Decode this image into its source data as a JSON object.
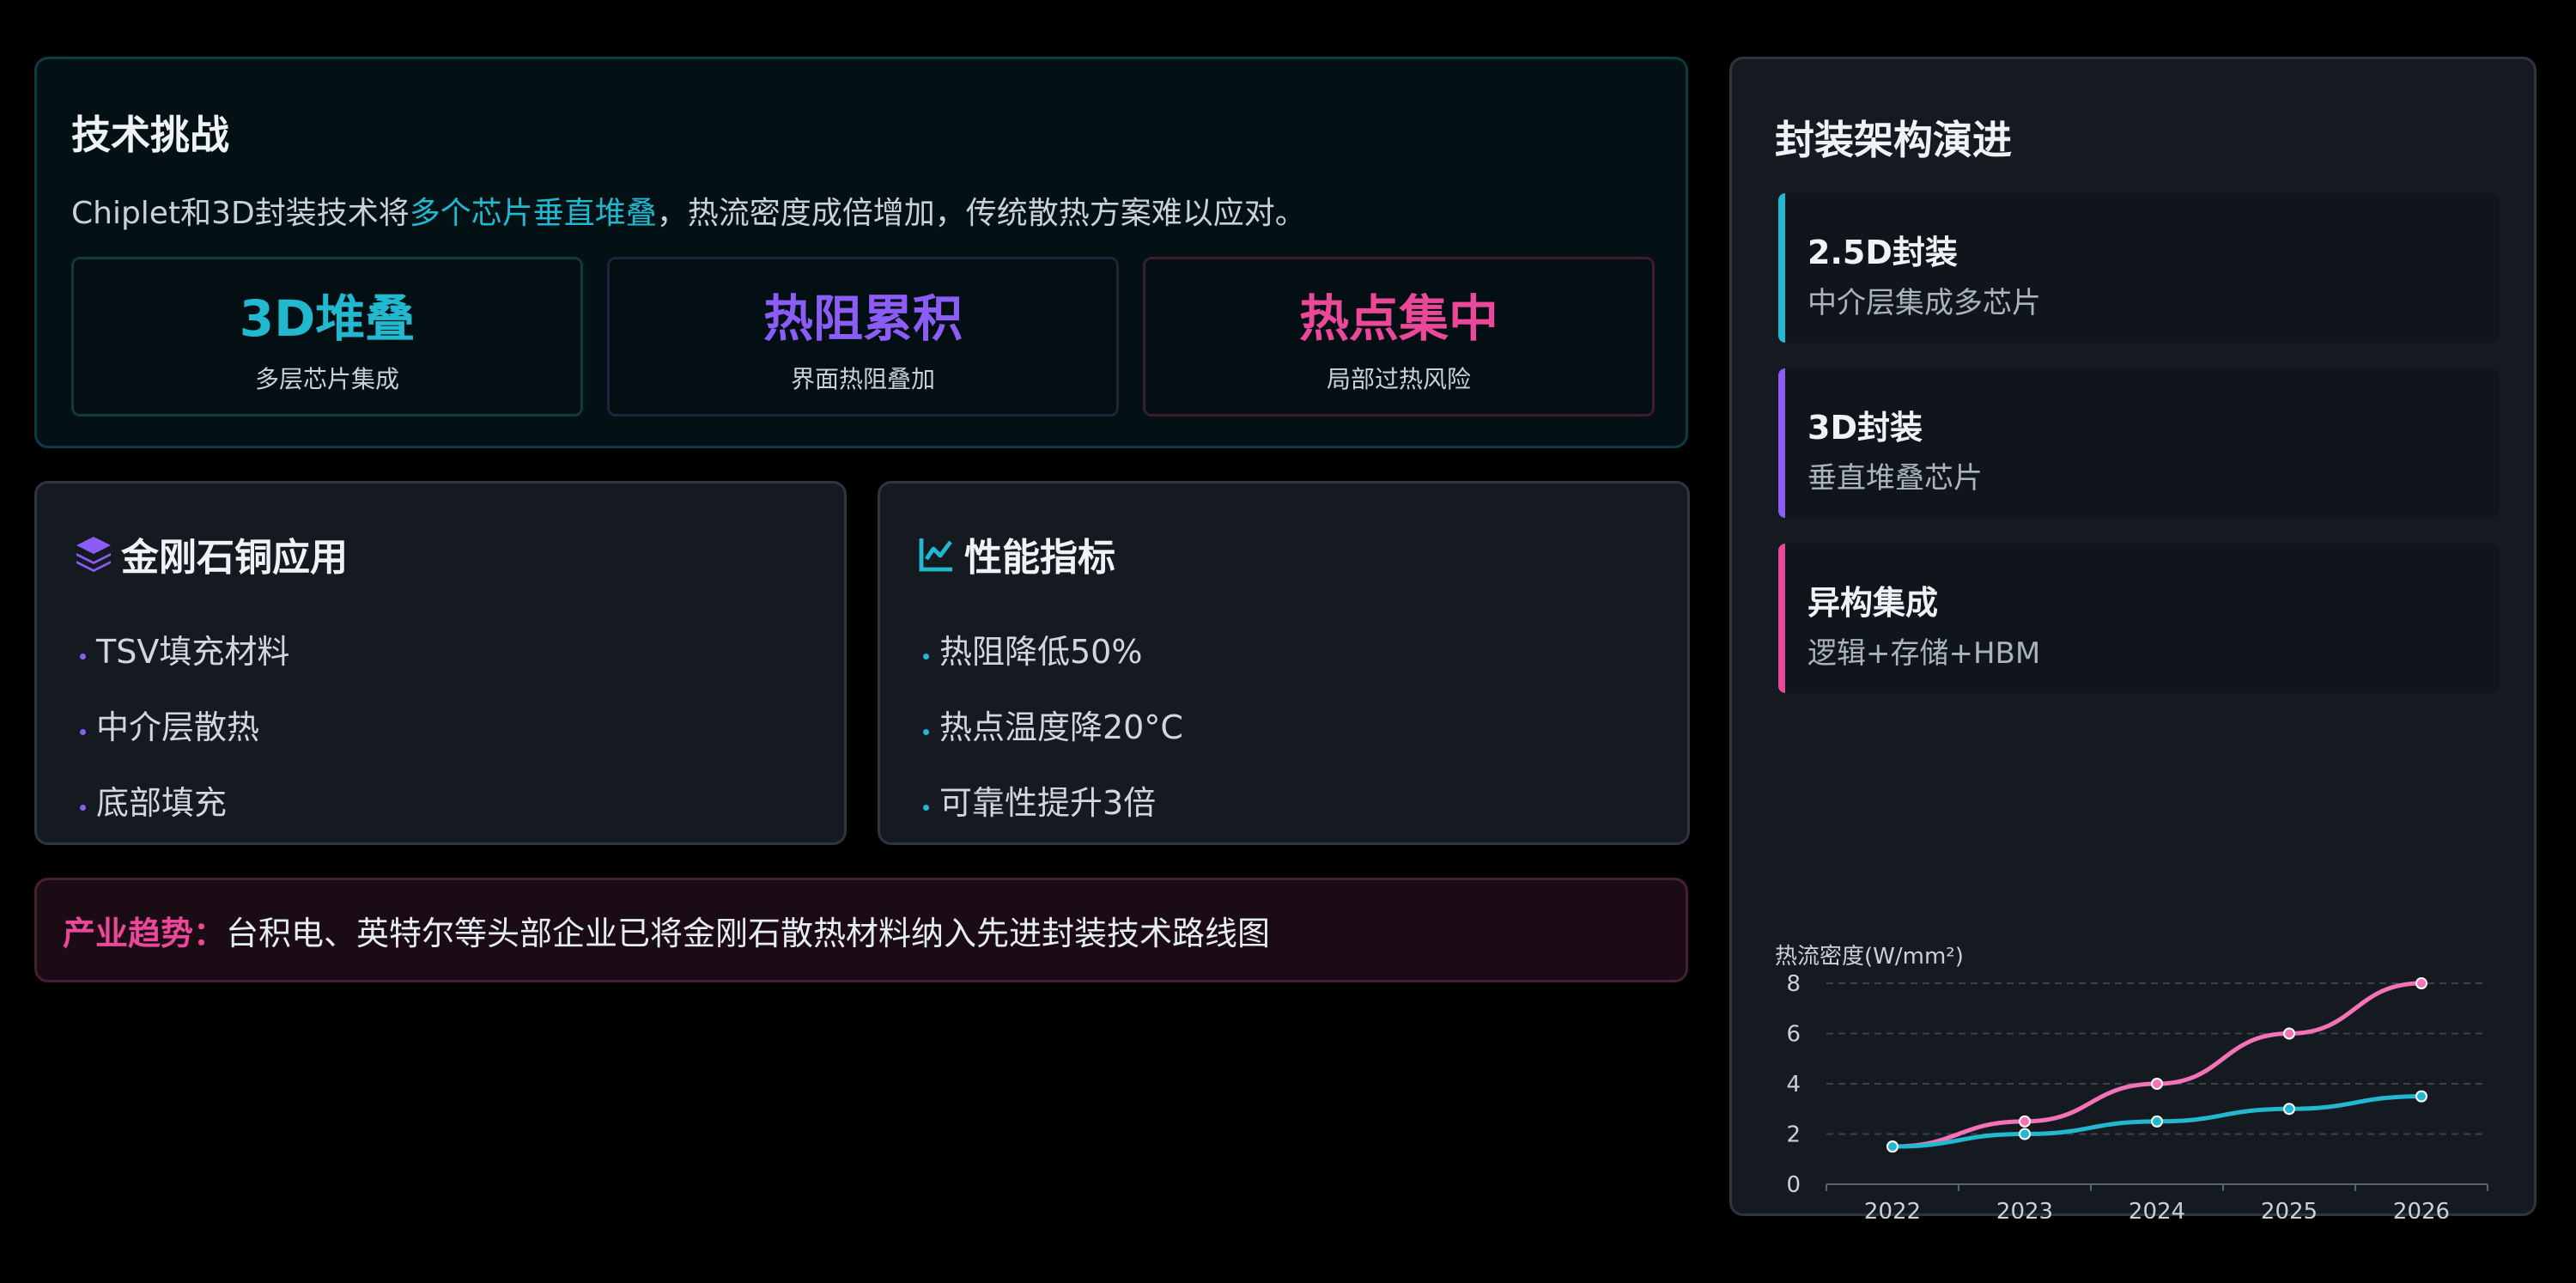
{
  "challenge": {
    "title": "技术挑战",
    "desc_pre": "Chiplet和3D封装技术将",
    "desc_highlight": "多个芯片垂直堆叠",
    "desc_post": "，热流密度成倍增加，传统散热方案难以应对。",
    "stats": [
      {
        "value": "3D堆叠",
        "label": "多层芯片集成",
        "color": "#22b8cf"
      },
      {
        "value": "热阻累积",
        "label": "界面热阻叠加",
        "color": "#8b5cf6"
      },
      {
        "value": "热点集中",
        "label": "局部过热风险",
        "color": "#ec4899"
      }
    ]
  },
  "diamond": {
    "icon": "layers-icon",
    "title": "金刚石铜应用",
    "items": [
      "TSV填充材料",
      "中介层散热",
      "底部填充"
    ]
  },
  "performance": {
    "icon": "chart-line-icon",
    "title": "性能指标",
    "items": [
      "热阻降低50%",
      "热点温度降20°C",
      "可靠性提升3倍"
    ]
  },
  "trend": {
    "label": "产业趋势：",
    "text": "台积电、英特尔等头部企业已将金刚石散热材料纳入先进封装技术路线图"
  },
  "architecture": {
    "title": "封装架构演进",
    "items": [
      {
        "name": "2.5D封装",
        "desc": "中介层集成多芯片",
        "color": "#22b8cf"
      },
      {
        "name": "3D封装",
        "desc": "垂直堆叠芯片",
        "color": "#8b5cf6"
      },
      {
        "name": "异构集成",
        "desc": "逻辑+存储+HBM",
        "color": "#ec4899"
      }
    ]
  },
  "chart_data": {
    "type": "line",
    "ylabel": "热流密度(W/mm²)",
    "x": [
      "2022",
      "2023",
      "2024",
      "2025",
      "2026"
    ],
    "ylim": [
      0,
      8
    ],
    "yticks": [
      0,
      2,
      4,
      6,
      8
    ],
    "grid": true,
    "series": [
      {
        "values": [
          1.5,
          2.5,
          4,
          6,
          8
        ],
        "color": "#f472b6"
      },
      {
        "values": [
          1.5,
          2,
          2.5,
          3,
          3.5
        ],
        "color": "#22b8cf"
      }
    ]
  }
}
